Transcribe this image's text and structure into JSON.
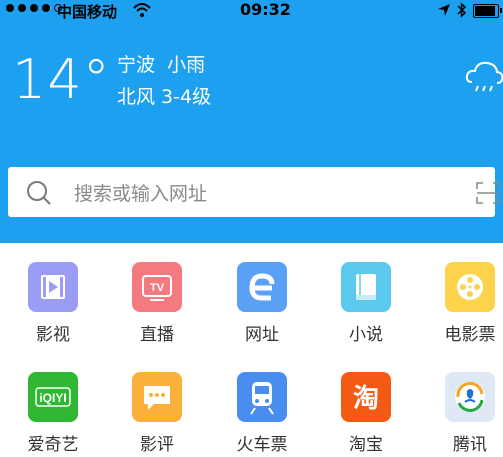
{
  "status_bar": {
    "carrier": "中国移动",
    "time": "09:32"
  },
  "weather": {
    "temperature": "14°",
    "city": "宁波",
    "condition": "小雨",
    "wind": "北风 3-4级"
  },
  "search": {
    "placeholder": "搜索或输入网址"
  },
  "shortcuts": [
    {
      "label": "影视",
      "icon": "video-icon",
      "color": "#9b9cf5"
    },
    {
      "label": "直播",
      "icon": "tv-icon",
      "color": "#f47a80"
    },
    {
      "label": "网址",
      "icon": "e-icon",
      "color": "#5aa0f5"
    },
    {
      "label": "小说",
      "icon": "book-icon",
      "color": "#5cc9ee"
    },
    {
      "label": "电影票",
      "icon": "film-reel-icon",
      "color": "#fcd34a"
    },
    {
      "label": "爱奇艺",
      "icon": "iqiyi-icon",
      "color": "#2fb734"
    },
    {
      "label": "影评",
      "icon": "comment-icon",
      "color": "#fbb03b"
    },
    {
      "label": "火车票",
      "icon": "train-icon",
      "color": "#4a8df0"
    },
    {
      "label": "淘宝",
      "icon": "taobao-icon",
      "color": "#f55a14"
    },
    {
      "label": "腾讯",
      "icon": "tencent-icon",
      "color": "#dfe9f5"
    }
  ]
}
